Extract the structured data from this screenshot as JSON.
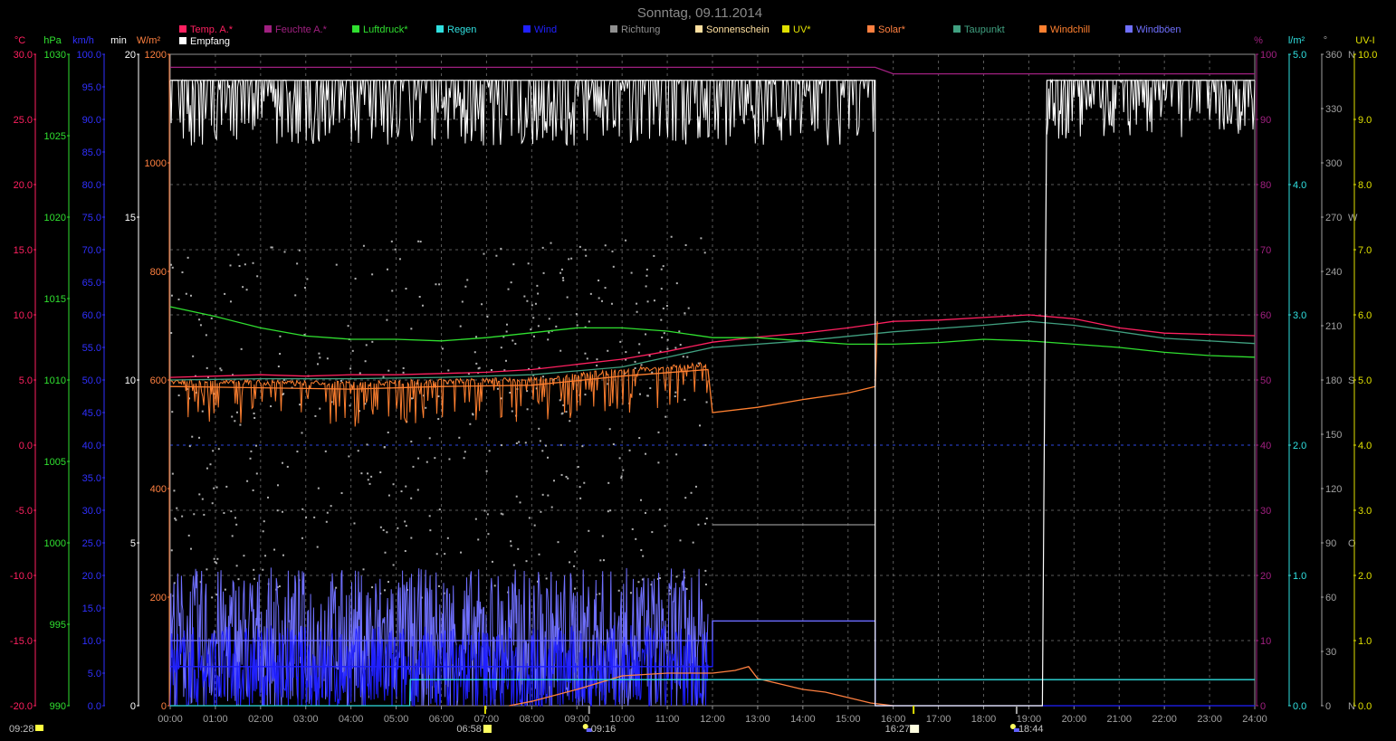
{
  "title": "Sonntag, 09.11.2014",
  "colors": {
    "background": "#000000",
    "grid": "#808080",
    "temp": "#ff2060",
    "humidity": "#a02080",
    "pressure": "#30e030",
    "rain": "#30e0e0",
    "wind": "#2020ff",
    "direction": "#a0a0a0",
    "sunshine": "#ffffff",
    "uv": "#e0e000",
    "solar": "#ff8040",
    "dewpoint": "#40a080",
    "windchill": "#ff8030",
    "gusts": "#7070ff",
    "reception": "#ffffff"
  },
  "legend": [
    {
      "label": "Temp. A.*",
      "color": "#ff2060"
    },
    {
      "label": "Feuchte A.*",
      "color": "#a02080"
    },
    {
      "label": "Luftdruck*",
      "color": "#30e030"
    },
    {
      "label": "Regen",
      "color": "#30e0e0"
    },
    {
      "label": "Wind",
      "color": "#2020ff"
    },
    {
      "label": "Richtung",
      "color": "#909090"
    },
    {
      "label": "Sonnenschein",
      "color": "#ffe0a0"
    },
    {
      "label": "UV*",
      "color": "#e0e000"
    },
    {
      "label": "Solar*",
      "color": "#ff8040"
    },
    {
      "label": "Taupunkt",
      "color": "#40a080"
    },
    {
      "label": "Windchill",
      "color": "#ff8030"
    },
    {
      "label": "Windböen",
      "color": "#7070ff"
    },
    {
      "label": "Empfang",
      "color": "#ffffff"
    }
  ],
  "axes_left": [
    {
      "unit": "°C",
      "color": "#ff2060",
      "ticks": [
        "30.0",
        "25.0",
        "20.0",
        "15.0",
        "10.0",
        "5.0",
        "0.0",
        "-5.0",
        "-10.0",
        "-15.0",
        "-20.0"
      ]
    },
    {
      "unit": "hPa",
      "color": "#30e030",
      "ticks": [
        "1030",
        "1025",
        "1020",
        "1015",
        "1010",
        "1005",
        "1000",
        "995",
        "990"
      ]
    },
    {
      "unit": "km/h",
      "color": "#3030ff",
      "ticks": [
        "100.0",
        "95.0",
        "90.0",
        "85.0",
        "80.0",
        "75.0",
        "70.0",
        "65.0",
        "60.0",
        "55.0",
        "50.0",
        "45.0",
        "40.0",
        "35.0",
        "30.0",
        "25.0",
        "20.0",
        "15.0",
        "10.0",
        "5.0",
        "0.0"
      ]
    },
    {
      "unit": "min",
      "color": "#ffffff",
      "ticks": [
        "20",
        "15",
        "10",
        "5",
        "0"
      ]
    },
    {
      "unit": "W/m²",
      "color": "#ff8040",
      "ticks": [
        "1200",
        "1000",
        "800",
        "600",
        "400",
        "200",
        "0"
      ]
    }
  ],
  "axes_right": [
    {
      "unit": "%",
      "color": "#a02080",
      "ticks": [
        "100",
        "90",
        "80",
        "70",
        "60",
        "50",
        "40",
        "30",
        "20",
        "10",
        "0"
      ]
    },
    {
      "unit": "l/m²",
      "color": "#30e0e0",
      "ticks": [
        "5.0",
        "4.0",
        "3.0",
        "2.0",
        "1.0",
        "0.0"
      ]
    },
    {
      "unit": "°",
      "color": "#a0a0a0",
      "ticks": [
        "360",
        "330",
        "300",
        "270",
        "240",
        "210",
        "180",
        "150",
        "120",
        "90",
        "60",
        "30",
        "0"
      ],
      "compass": {
        "360": "N",
        "270": "W",
        "180": "S",
        "90": "O",
        "0": "N"
      }
    },
    {
      "unit": "UV-I",
      "color": "#e0e000",
      "ticks": [
        "10.0",
        "9.0",
        "8.0",
        "7.0",
        "6.0",
        "5.0",
        "4.0",
        "3.0",
        "2.0",
        "1.0",
        "0.0"
      ]
    }
  ],
  "x_ticks": [
    "00:00",
    "01:00",
    "02:00",
    "03:00",
    "04:00",
    "05:00",
    "06:00",
    "07:00",
    "08:00",
    "09:00",
    "10:00",
    "11:00",
    "12:00",
    "13:00",
    "14:00",
    "15:00",
    "16:00",
    "17:00",
    "18:00",
    "19:00",
    "20:00",
    "21:00",
    "22:00",
    "23:00",
    "24:00"
  ],
  "sun_events": [
    {
      "label": "09:28",
      "type": "sunshine-duration",
      "hour": null
    },
    {
      "label": "06:58",
      "type": "sunrise",
      "hour": 6.97
    },
    {
      "label": "09:16",
      "type": "moonset",
      "hour": 9.27
    },
    {
      "label": "16:27",
      "type": "sunset",
      "hour": 16.45
    },
    {
      "label": "18:44",
      "type": "moonrise",
      "hour": 18.73
    }
  ],
  "chart_data": {
    "type": "line",
    "title": "Sonntag, 09.11.2014",
    "xlim": [
      0,
      24
    ],
    "series": [
      {
        "name": "Temp. A.*",
        "unit": "°C",
        "ylim": [
          -20,
          30
        ],
        "x": [
          0,
          1,
          2,
          3,
          4,
          5,
          6,
          7,
          8,
          9,
          10,
          11,
          12,
          13,
          14,
          15,
          15.6,
          16,
          17,
          18,
          19,
          20,
          21,
          22,
          23,
          24
        ],
        "y": [
          5.2,
          5.3,
          5.4,
          5.3,
          5.4,
          5.4,
          5.5,
          5.6,
          5.8,
          6.2,
          6.6,
          7.2,
          7.9,
          8.3,
          8.6,
          9.0,
          9.3,
          9.5,
          9.6,
          9.8,
          10.0,
          9.7,
          9.0,
          8.6,
          8.5,
          8.4
        ]
      },
      {
        "name": "Feuchte A.*",
        "unit": "%",
        "ylim": [
          0,
          100
        ],
        "x": [
          0,
          2,
          4,
          6,
          8,
          10,
          12,
          14,
          15.6,
          16,
          18,
          20,
          22,
          24
        ],
        "y": [
          98,
          98,
          98,
          98,
          98,
          98,
          98,
          98,
          98,
          97,
          97,
          97,
          97,
          97
        ]
      },
      {
        "name": "Luftdruck*",
        "unit": "hPa",
        "ylim": [
          990,
          1030
        ],
        "x": [
          0,
          1,
          2,
          3,
          4,
          5,
          6,
          7,
          8,
          9,
          10,
          11,
          12,
          13,
          14,
          15,
          16,
          17,
          18,
          19,
          20,
          21,
          22,
          23,
          24
        ],
        "y": [
          1014.5,
          1013.9,
          1013.2,
          1012.7,
          1012.5,
          1012.5,
          1012.4,
          1012.6,
          1012.9,
          1013.2,
          1013.2,
          1013.0,
          1012.6,
          1012.6,
          1012.4,
          1012.2,
          1012.2,
          1012.3,
          1012.5,
          1012.4,
          1012.2,
          1012.0,
          1011.7,
          1011.5,
          1011.4
        ]
      },
      {
        "name": "Taupunkt",
        "unit": "°C",
        "ylim": [
          -20,
          30
        ],
        "x": [
          0,
          2,
          4,
          6,
          8,
          10,
          12,
          14,
          16,
          18,
          19,
          20,
          22,
          24
        ],
        "y": [
          5.0,
          5.1,
          5.1,
          5.2,
          5.4,
          6.0,
          7.5,
          8.0,
          8.7,
          9.2,
          9.5,
          9.2,
          8.2,
          7.8
        ]
      },
      {
        "name": "Windchill",
        "unit": "°C",
        "ylim": [
          -20,
          30
        ],
        "x": [
          0,
          2,
          4,
          6,
          8,
          10,
          11.9,
          12,
          13,
          14,
          15,
          15.6,
          15.65
        ],
        "y": [
          4.5,
          4.4,
          4.3,
          4.5,
          4.6,
          5.3,
          5.8,
          2.5,
          2.9,
          3.5,
          4.0,
          4.5,
          9.5
        ]
      },
      {
        "name": "Solar*",
        "unit": "W/m²",
        "ylim": [
          0,
          1200
        ],
        "x": [
          7.5,
          8,
          9,
          10,
          11,
          12,
          12.5,
          12.8,
          13,
          13.5,
          14,
          14.5,
          15,
          15.5,
          15.8,
          16
        ],
        "y": [
          0,
          8,
          30,
          55,
          60,
          60,
          65,
          72,
          50,
          40,
          30,
          25,
          15,
          5,
          2,
          0
        ]
      },
      {
        "name": "Regen",
        "unit": "l/m²",
        "ylim": [
          0,
          5
        ],
        "x": [
          0,
          5.3,
          5.31,
          24
        ],
        "y": [
          0,
          0,
          0.2,
          0.2
        ]
      },
      {
        "name": "Wind",
        "unit": "km/h",
        "ylim": [
          0,
          100
        ],
        "x": [
          0,
          12,
          12,
          15.6,
          15.6,
          24
        ],
        "y": [
          6,
          6,
          13,
          13,
          0,
          0
        ]
      },
      {
        "name": "Windböen",
        "unit": "km/h",
        "ylim": [
          0,
          100
        ],
        "x": [
          0,
          12,
          12,
          15.6
        ],
        "y": [
          10,
          10,
          13,
          13
        ]
      },
      {
        "name": "Richtung",
        "unit": "°",
        "ylim": [
          0,
          360
        ],
        "x": [
          12,
          15.6
        ],
        "y": [
          100,
          100
        ]
      },
      {
        "name": "Sonnenschein",
        "unit": "min",
        "ylim": [
          0,
          20
        ],
        "x": [],
        "y": []
      },
      {
        "name": "Empfang",
        "unit": "%",
        "ylim": [
          0,
          100
        ],
        "x": [
          0,
          15.6,
          15.6,
          16,
          19.3,
          19.4,
          24
        ],
        "y": [
          96,
          96,
          0,
          0,
          0,
          96,
          96
        ]
      }
    ]
  }
}
